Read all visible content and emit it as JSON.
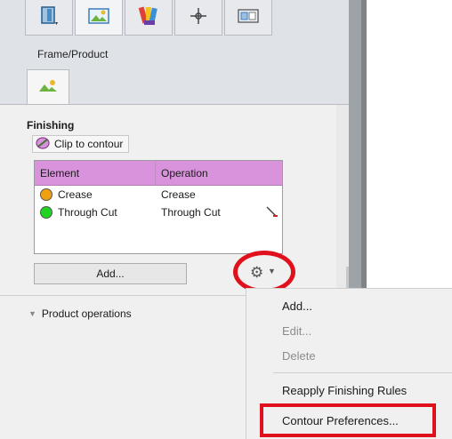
{
  "tabs": [
    {
      "icon": "page-fold-icon"
    },
    {
      "icon": "landscape-icon"
    },
    {
      "icon": "palette-icon"
    },
    {
      "icon": "crosshair-icon"
    },
    {
      "icon": "frame-icon"
    }
  ],
  "subpanel": {
    "label": "Frame/Product",
    "tab_icon": "image-icon"
  },
  "finishing": {
    "title": "Finishing",
    "clip_label": "Clip to contour",
    "columns": [
      "Element",
      "Operation"
    ],
    "rows": [
      {
        "element": "Crease",
        "operation": "Crease",
        "color": "#f0a010"
      },
      {
        "element": "Through Cut",
        "operation": "Through Cut",
        "color": "#22d322"
      }
    ],
    "add_label": "Add...",
    "gear_icon": "gear-icon"
  },
  "product_ops_label": "Product operations",
  "context_menu": {
    "items": [
      {
        "label": "Add...",
        "enabled": true
      },
      {
        "label": "Edit...",
        "enabled": false
      },
      {
        "label": "Delete",
        "enabled": false
      },
      {
        "label": "Reapply Finishing Rules",
        "enabled": true
      },
      {
        "label": "Contour Preferences...",
        "enabled": true
      }
    ]
  },
  "colors": {
    "highlight": "#e0101c",
    "table_header": "#d993dc"
  }
}
